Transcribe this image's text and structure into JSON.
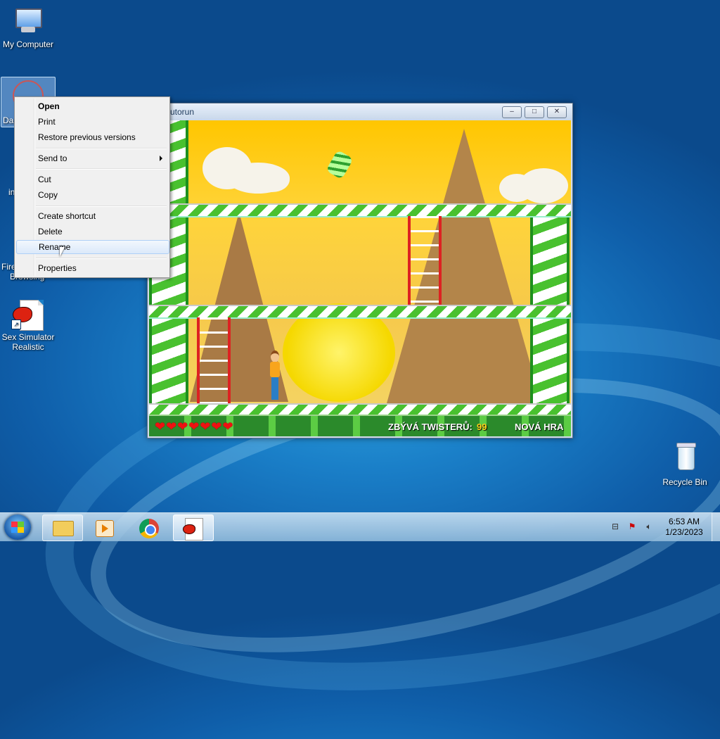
{
  "desktop": {
    "icons": [
      {
        "label": "My Computer"
      },
      {
        "label": "Da"
      },
      {
        "label": "in"
      },
      {
        "label": "Fire"
      },
      {
        "label": "Browsing"
      },
      {
        "label": "Sex Simulator Realistic"
      },
      {
        "label": "Recycle Bin"
      }
    ]
  },
  "window": {
    "title": "utorun",
    "min_glyph": "–",
    "max_glyph": "□",
    "close_glyph": "✕"
  },
  "game": {
    "hearts": "❤❤❤❤❤❤❤",
    "remaining_label": "ZBÝVÁ TWISTERŮ:",
    "remaining_count": "99",
    "new_game": "NOVÁ HRA"
  },
  "context_menu": {
    "items": [
      {
        "label": "Open"
      },
      {
        "label": "Print"
      },
      {
        "label": "Restore previous versions"
      },
      {
        "label": "Send to"
      },
      {
        "label": "Cut"
      },
      {
        "label": "Copy"
      },
      {
        "label": "Create shortcut"
      },
      {
        "label": "Delete"
      },
      {
        "label": "Rename"
      },
      {
        "label": "Properties"
      }
    ]
  },
  "taskbar": {
    "time": "6:53 AM",
    "date": "1/23/2023"
  },
  "colors": {
    "desktop_blue": "#1a7fc8",
    "candy_green": "#49c12f",
    "game_yellow": "#ffc600",
    "menu_highlight": "#dbe9fa"
  },
  "icons": [
    "computer-icon",
    "document-icon",
    "recycle-bin-icon",
    "start-icon",
    "folder-icon",
    "media-player-icon",
    "chrome-icon",
    "network-icon",
    "flag-icon",
    "volume-icon"
  ]
}
